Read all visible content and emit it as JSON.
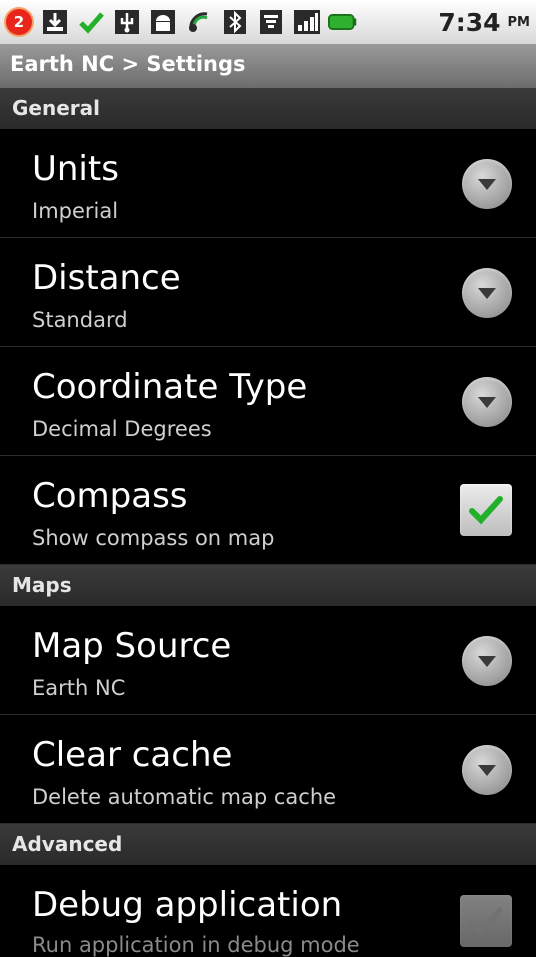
{
  "status_bar": {
    "notification_count": "2",
    "time": "7:34",
    "ampm": "PM",
    "icons": [
      "back-arrow-icon",
      "download-icon",
      "check-icon",
      "usb-icon",
      "android-icon",
      "gps-icon",
      "bluetooth-icon",
      "wifi-icon",
      "signal-icon",
      "battery-icon"
    ],
    "battery_color": "#2fb02f"
  },
  "title_bar": {
    "title": "Earth NC > Settings"
  },
  "sections": {
    "general": "General",
    "maps": "Maps",
    "advanced": "Advanced"
  },
  "rows": {
    "units": {
      "title": "Units",
      "summary": "Imperial"
    },
    "distance": {
      "title": "Distance",
      "summary": "Standard"
    },
    "coordinate": {
      "title": "Coordinate Type",
      "summary": "Decimal Degrees"
    },
    "compass": {
      "title": "Compass",
      "summary": "Show compass on map",
      "checked": true
    },
    "map_source": {
      "title": "Map Source",
      "summary": "Earth NC"
    },
    "clear_cache": {
      "title": "Clear cache",
      "summary": "Delete automatic map cache"
    },
    "debug": {
      "title": "Debug application",
      "summary": "Run application in debug mode",
      "checked": false
    }
  },
  "colors": {
    "check_green": "#22b02a"
  }
}
